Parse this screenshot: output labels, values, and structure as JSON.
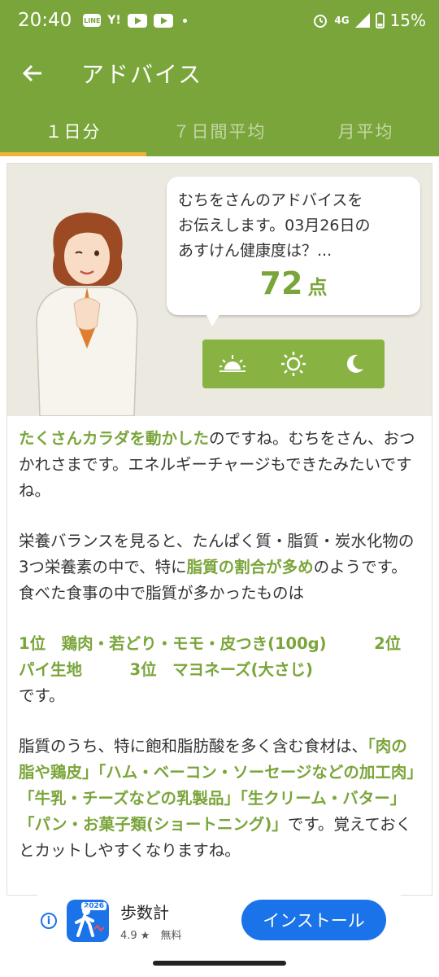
{
  "status_bar": {
    "time": "20:40",
    "notif_line": "LINE",
    "notif_yahoo": "Y!",
    "network": "4G",
    "battery": "15%"
  },
  "appbar": {
    "title": "アドバイス"
  },
  "tabs": [
    {
      "label": "１日分",
      "active": true
    },
    {
      "label": "７日間平均",
      "active": false
    },
    {
      "label": "月平均",
      "active": false
    }
  ],
  "bubble": {
    "text": "むちをさんのアドバイスを\nお伝えします。03月26日の\nあすけん健康度は？...",
    "score": "72",
    "score_unit": "点"
  },
  "time_toggle": [
    "sunrise-icon",
    "sun-icon",
    "moon-icon"
  ],
  "advice": {
    "p1_hl": "たくさんカラダを動かした",
    "p1_rest": "のですね。むちをさん、おつかれさまです。エネルギーチャージもできたみたいですね。",
    "p2_a": "栄養バランスを見ると、たんぱく質・脂質・炭水化物の3つ栄養素の中で、特に",
    "p2_hl": "脂質の割合が多め",
    "p2_b": "のようです。食べた食事の中で脂質が多かったものは",
    "rank1": "1位　鶏肉・若どり・モモ・皮つき(100g)",
    "rank2": "2位　パイ生地",
    "rank3": "3位　マヨネーズ(大さじ)",
    "p3_tail": "です。",
    "p4_a": "脂質のうち、特に飽和脂肪酸を多く含む食材は、",
    "p4_hl": "「肉の脂や鶏皮」「ハム・ベーコン・ソーセージなどの加工肉」「牛乳・チーズなどの乳製品」「生クリーム・バター」「パン・お菓子類(ショートニング)」",
    "p4_b": "です。覚えておくとカットしやすくなりますね。"
  },
  "ad": {
    "badge": "2026",
    "name": "歩数計",
    "rating": "4.9 ★",
    "price": "無料",
    "install_label": "インストール"
  },
  "colors": {
    "primary": "#7aa53a",
    "accent_tab": "#f0b33a",
    "ad_blue": "#1a73e8"
  }
}
